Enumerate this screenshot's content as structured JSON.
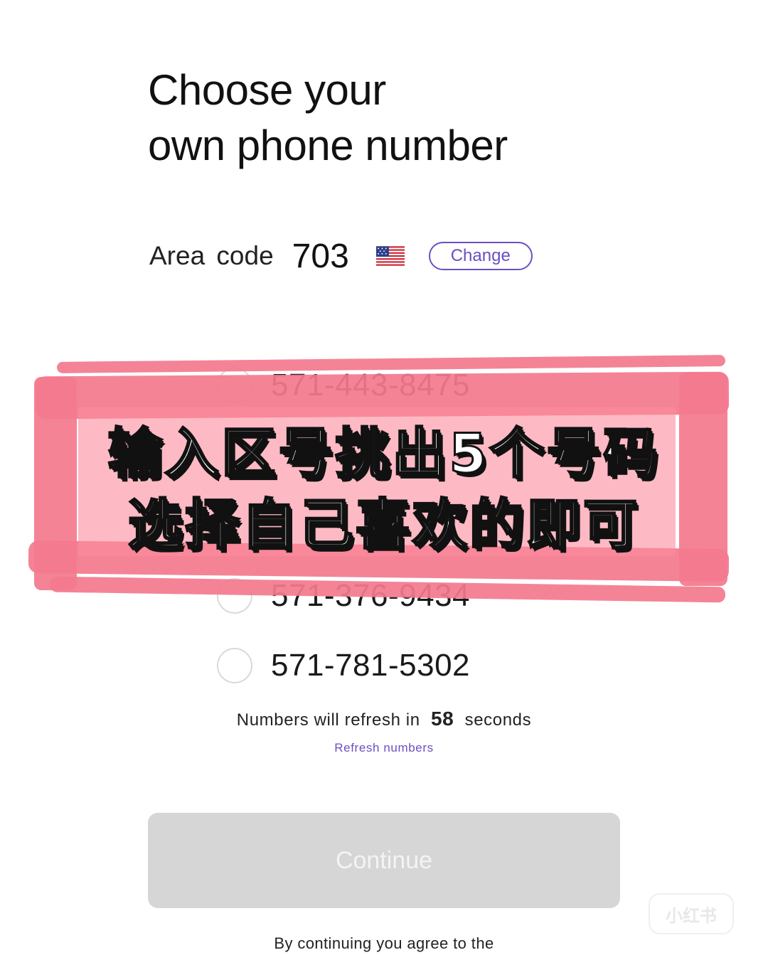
{
  "page": {
    "title_line1": "Choose your",
    "title_line2": "own phone number"
  },
  "area": {
    "label": "Area code",
    "value": "703",
    "flag_icon": "us-flag-icon",
    "change_label": "Change"
  },
  "numbers": [
    "571-443-8475",
    "571-376-9434",
    "571-781-5302"
  ],
  "overlay": {
    "line1": "输入区号挑出5个号码",
    "line2": "选择自己喜欢的即可",
    "color": "#f37a8e"
  },
  "refresh": {
    "prefix": "Numbers will refresh in",
    "seconds": "58",
    "suffix": "seconds",
    "link": "Refresh numbers"
  },
  "continue": {
    "label": "Continue"
  },
  "legal": {
    "text": "By continuing you agree to the"
  },
  "watermark": {
    "text": "小红书"
  },
  "colors": {
    "accent": "#6b4fc3",
    "button_disabled": "#d6d6d6"
  }
}
